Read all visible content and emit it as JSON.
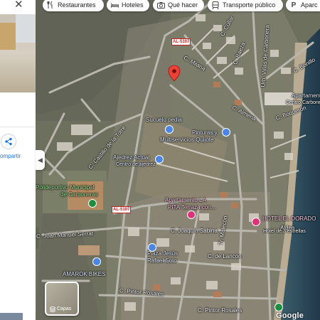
{
  "chips": [
    {
      "label": "Restaurantes",
      "icon": "restaurant-icon"
    },
    {
      "label": "Hoteles",
      "icon": "hotel-icon"
    },
    {
      "label": "Qué hacer",
      "icon": "camera-icon"
    },
    {
      "label": "Transporte público",
      "icon": "transit-icon"
    },
    {
      "label": "Aparc",
      "icon": "parking-icon"
    }
  ],
  "panel": {
    "share_label": "ompartir"
  },
  "road_shields": [
    "AL-5107",
    "AL-5107"
  ],
  "streets": [
    "C. Milana",
    "C. Cullar",
    "C. Baeza",
    "C. Bonillo",
    "Urb. Villas de Carbonera",
    "C. Almeria",
    "C. Boquerón",
    "C. Castillo de la Torre",
    "C. Joaquín Sabina",
    "Tr. Malecón",
    "C. de Lancón",
    "C. Pintor Rosales",
    "C. Pintor Rosales",
    "C. Joan Manuel Serrat",
    "Aldea"
  ],
  "pois": {
    "sucuelo": "Sucuelo pedia",
    "pinturas_1": "Pinturas y",
    "pinturas_2": "Multiservicios Quijote",
    "ajedrez_1": "Ajedrez Actual",
    "ajedrez_2": "Centro de ajedrez",
    "polideportivo_1": "Polideportivo Municipal",
    "polideportivo_2": "de Carboneras",
    "apartamento_1": "Apartamento LA",
    "apartamento_2": "PITA Terraza con...",
    "plaza_1": "Plaza Jesús",
    "plaza_2": "Rafael Soto",
    "amarok": "AMAROK BIKES",
    "hotel_1": "HOTEL EL DORADO",
    "hotel_2": "Hotel de 3 estrellas",
    "apartamento_right_1": "Apartamento",
    "apartamento_right_2": "Centro Carboneras"
  },
  "layers_label": "Capas",
  "google_label": "Google",
  "colors": {
    "pin": "#ea4335",
    "marker_blue": "#4a86e8",
    "marker_green": "#1e8e3e",
    "marker_pink": "#e0307a",
    "sea": "#2a4a5e"
  }
}
